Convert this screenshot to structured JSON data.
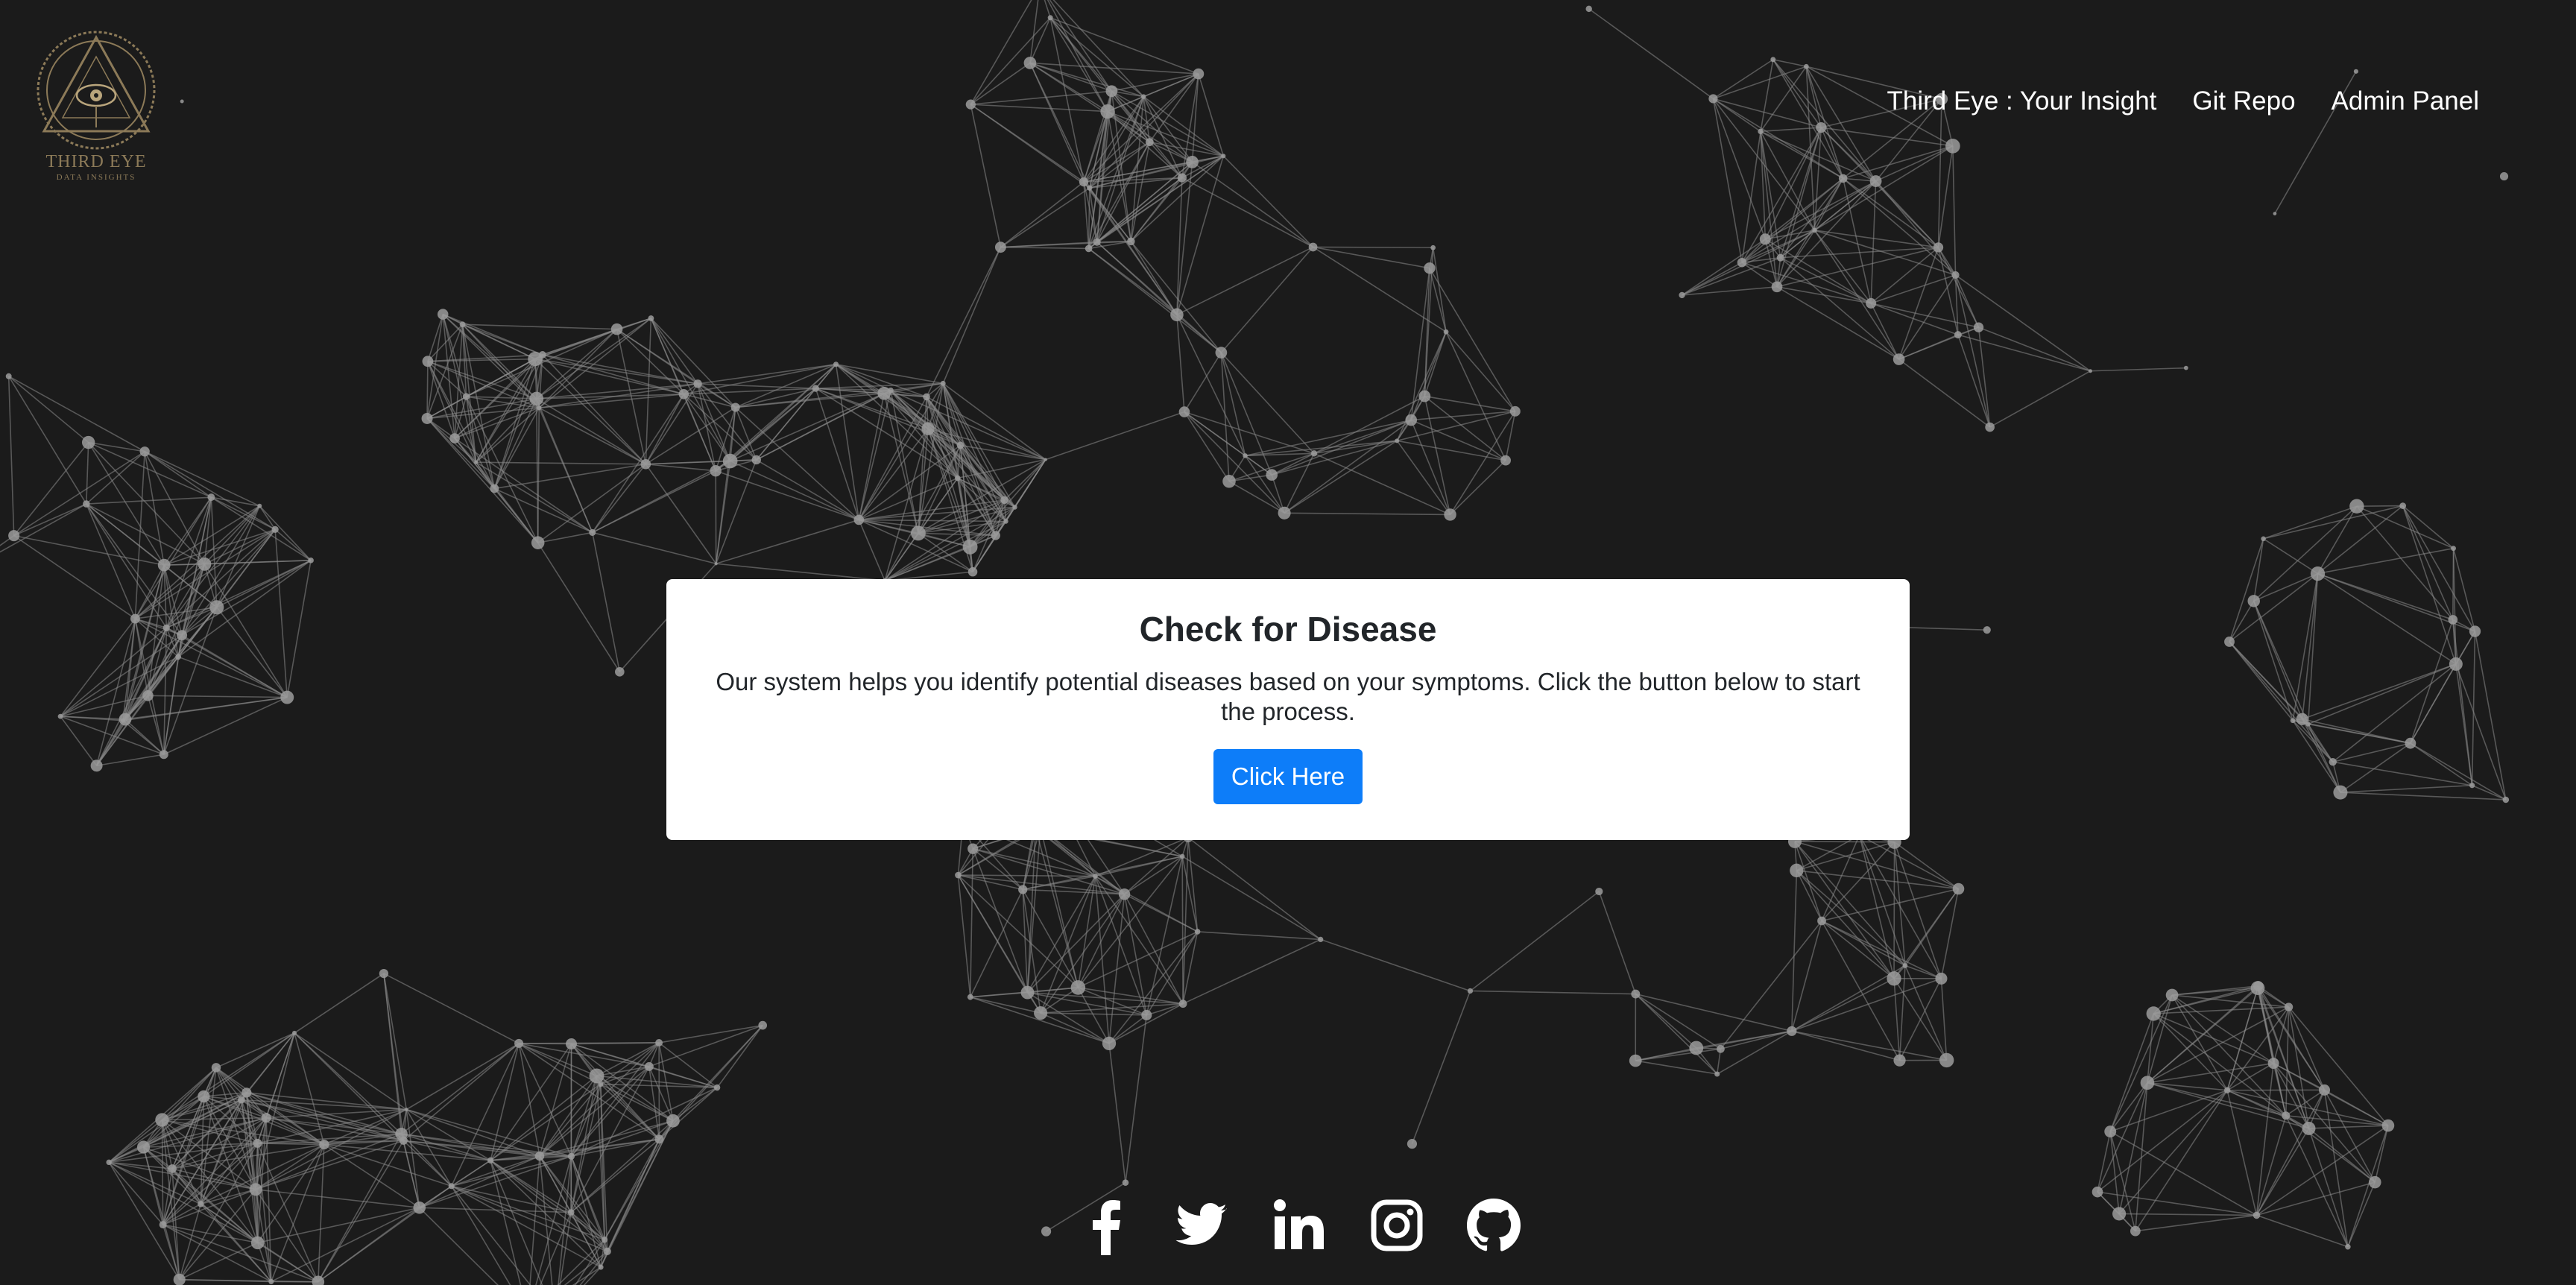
{
  "brand": {
    "logo_title": "THIRD EYE",
    "logo_subtitle": "DATA INSIGHTS"
  },
  "nav": {
    "items": [
      {
        "label": "Third Eye : Your Insight"
      },
      {
        "label": "Git Repo"
      },
      {
        "label": "Admin Panel"
      }
    ]
  },
  "card": {
    "title": "Check for Disease",
    "description": "Our system helps you identify potential diseases based on your symptoms. Click the button below to start the process.",
    "button_label": "Click Here"
  },
  "social": {
    "icons": [
      "facebook-icon",
      "twitter-icon",
      "linkedin-icon",
      "instagram-icon",
      "github-icon"
    ]
  },
  "colors": {
    "background": "#1b1b1b",
    "card": "#ffffff",
    "button": "#0d7df9",
    "network": "#8a8a8a",
    "logo_gold": "#8c7a58"
  }
}
